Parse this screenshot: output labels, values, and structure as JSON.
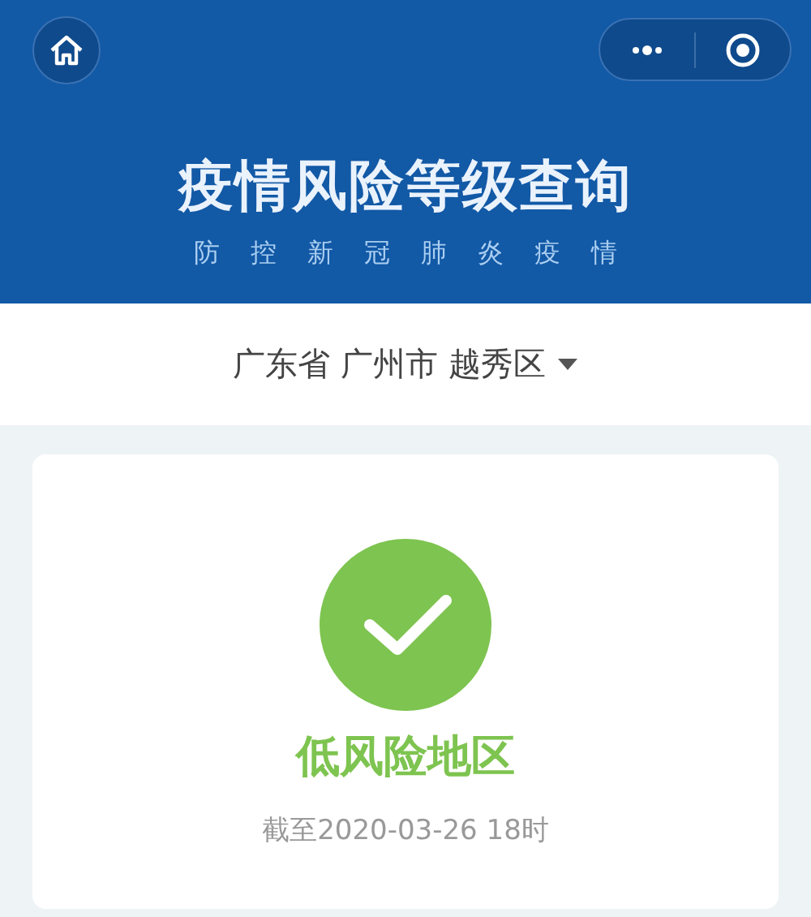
{
  "header": {
    "title": "疫情风险等级查询",
    "subtitle": "防控新冠肺炎疫情"
  },
  "location": {
    "text": "广东省 广州市 越秀区"
  },
  "result": {
    "kind": "low",
    "label": "低风险地区",
    "updated": "截至2020-03-26 18时"
  }
}
